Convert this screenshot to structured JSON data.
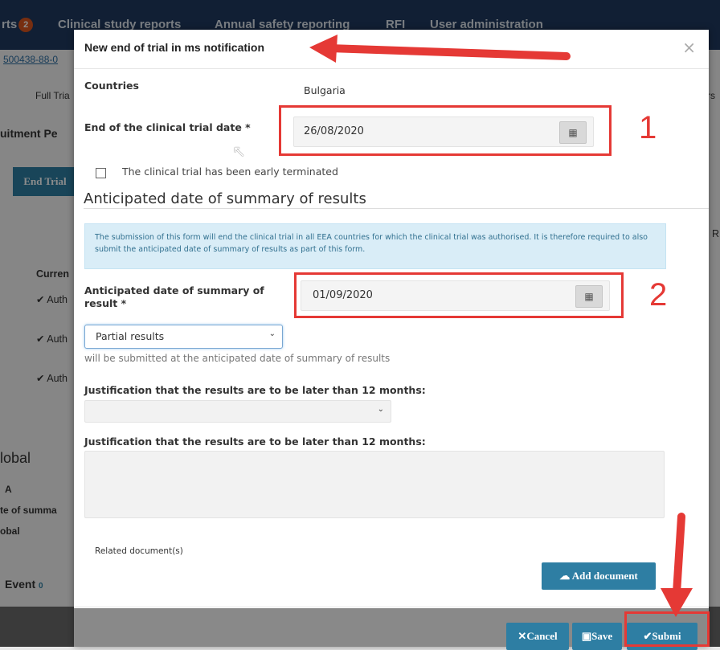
{
  "top_nav": {
    "items": [
      {
        "label": "rts",
        "badge": "2"
      },
      {
        "label": "Clinical study reports"
      },
      {
        "label": "Annual safety reporting"
      },
      {
        "label": "RFI"
      },
      {
        "label": "User administration"
      }
    ]
  },
  "background": {
    "trial_number": "500438-88-0",
    "full_trial": "Full Tria",
    "recruitment": "uitment Pe",
    "end_trial_button": "End Trial",
    "current": "Curren",
    "auth_rows": [
      "Auth",
      "Auth",
      "Auth"
    ],
    "r_col": "R",
    "rs_col": "rs",
    "global_title": "lobal",
    "a": "A",
    "date_of_summary": "te of summa",
    "obal": "obal",
    "event": "Event",
    "event_badge": "0"
  },
  "modal": {
    "title": "New end of trial in ms notification",
    "close": "×",
    "countries_label": "Countries",
    "countries_value": "Bulgaria",
    "end_date_label": "End of the clinical trial date *",
    "end_date_value": "26/08/2020",
    "early_terminated_label": "The clinical trial has been early terminated",
    "section_title": "Anticipated date of summary of results",
    "info_text": "The submission of this form will end the clinical trial in all EEA countries for which the clinical trial was authorised. It is therefore required to also submit the anticipated date of summary of results as part of this form.",
    "anticipated_label": "Anticipated date of summary of result *",
    "anticipated_value": "01/09/2020",
    "results_type_selected": "Partial results",
    "results_hint": "will be submitted at the anticipated date of summary of results",
    "justification_label_1": "Justification that the results are to be later than 12 months:",
    "justification_label_2": "Justification that the results are to be later than 12 months:",
    "related_docs_label": "Related document(s)",
    "add_document": "Add document",
    "cancel": "Cancel",
    "save": "Save",
    "submit": "Submi"
  },
  "annotations": {
    "marker_1": "1",
    "marker_2": "2",
    "color": "#e53935"
  },
  "colors": {
    "nav": "#1f3a5f",
    "button": "#2e7ea3",
    "info_bg": "#d9edf7"
  }
}
